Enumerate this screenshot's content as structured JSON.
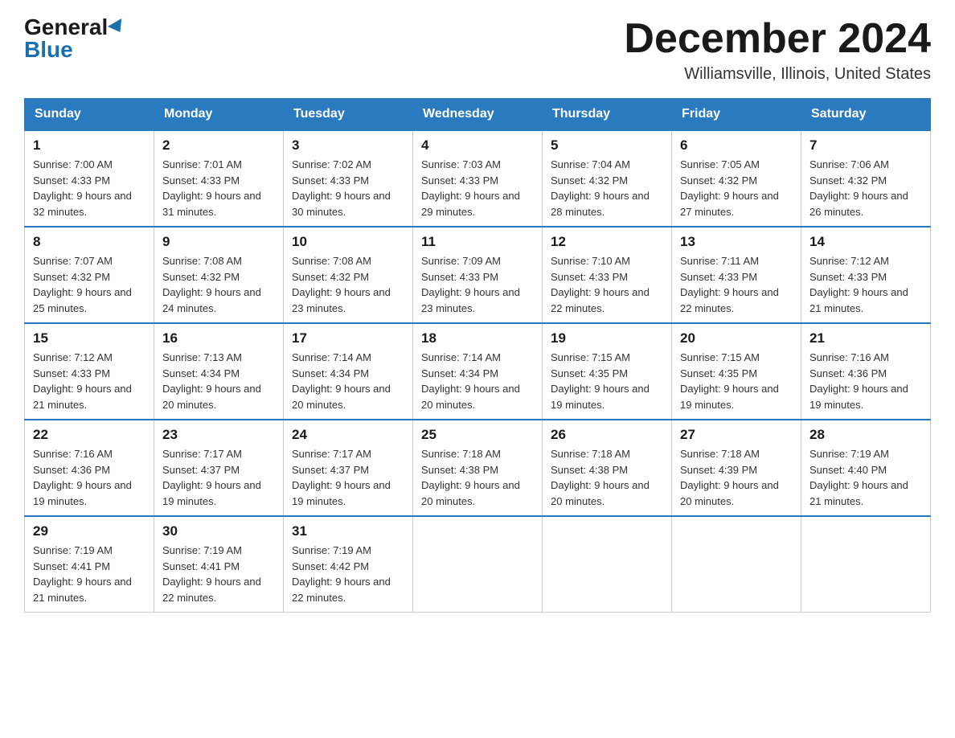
{
  "logo": {
    "general": "General",
    "blue": "Blue"
  },
  "title": "December 2024",
  "subtitle": "Williamsville, Illinois, United States",
  "days_of_week": [
    "Sunday",
    "Monday",
    "Tuesday",
    "Wednesday",
    "Thursday",
    "Friday",
    "Saturday"
  ],
  "weeks": [
    [
      {
        "day": "1",
        "sunrise": "Sunrise: 7:00 AM",
        "sunset": "Sunset: 4:33 PM",
        "daylight": "Daylight: 9 hours and 32 minutes."
      },
      {
        "day": "2",
        "sunrise": "Sunrise: 7:01 AM",
        "sunset": "Sunset: 4:33 PM",
        "daylight": "Daylight: 9 hours and 31 minutes."
      },
      {
        "day": "3",
        "sunrise": "Sunrise: 7:02 AM",
        "sunset": "Sunset: 4:33 PM",
        "daylight": "Daylight: 9 hours and 30 minutes."
      },
      {
        "day": "4",
        "sunrise": "Sunrise: 7:03 AM",
        "sunset": "Sunset: 4:33 PM",
        "daylight": "Daylight: 9 hours and 29 minutes."
      },
      {
        "day": "5",
        "sunrise": "Sunrise: 7:04 AM",
        "sunset": "Sunset: 4:32 PM",
        "daylight": "Daylight: 9 hours and 28 minutes."
      },
      {
        "day": "6",
        "sunrise": "Sunrise: 7:05 AM",
        "sunset": "Sunset: 4:32 PM",
        "daylight": "Daylight: 9 hours and 27 minutes."
      },
      {
        "day": "7",
        "sunrise": "Sunrise: 7:06 AM",
        "sunset": "Sunset: 4:32 PM",
        "daylight": "Daylight: 9 hours and 26 minutes."
      }
    ],
    [
      {
        "day": "8",
        "sunrise": "Sunrise: 7:07 AM",
        "sunset": "Sunset: 4:32 PM",
        "daylight": "Daylight: 9 hours and 25 minutes."
      },
      {
        "day": "9",
        "sunrise": "Sunrise: 7:08 AM",
        "sunset": "Sunset: 4:32 PM",
        "daylight": "Daylight: 9 hours and 24 minutes."
      },
      {
        "day": "10",
        "sunrise": "Sunrise: 7:08 AM",
        "sunset": "Sunset: 4:32 PM",
        "daylight": "Daylight: 9 hours and 23 minutes."
      },
      {
        "day": "11",
        "sunrise": "Sunrise: 7:09 AM",
        "sunset": "Sunset: 4:33 PM",
        "daylight": "Daylight: 9 hours and 23 minutes."
      },
      {
        "day": "12",
        "sunrise": "Sunrise: 7:10 AM",
        "sunset": "Sunset: 4:33 PM",
        "daylight": "Daylight: 9 hours and 22 minutes."
      },
      {
        "day": "13",
        "sunrise": "Sunrise: 7:11 AM",
        "sunset": "Sunset: 4:33 PM",
        "daylight": "Daylight: 9 hours and 22 minutes."
      },
      {
        "day": "14",
        "sunrise": "Sunrise: 7:12 AM",
        "sunset": "Sunset: 4:33 PM",
        "daylight": "Daylight: 9 hours and 21 minutes."
      }
    ],
    [
      {
        "day": "15",
        "sunrise": "Sunrise: 7:12 AM",
        "sunset": "Sunset: 4:33 PM",
        "daylight": "Daylight: 9 hours and 21 minutes."
      },
      {
        "day": "16",
        "sunrise": "Sunrise: 7:13 AM",
        "sunset": "Sunset: 4:34 PM",
        "daylight": "Daylight: 9 hours and 20 minutes."
      },
      {
        "day": "17",
        "sunrise": "Sunrise: 7:14 AM",
        "sunset": "Sunset: 4:34 PM",
        "daylight": "Daylight: 9 hours and 20 minutes."
      },
      {
        "day": "18",
        "sunrise": "Sunrise: 7:14 AM",
        "sunset": "Sunset: 4:34 PM",
        "daylight": "Daylight: 9 hours and 20 minutes."
      },
      {
        "day": "19",
        "sunrise": "Sunrise: 7:15 AM",
        "sunset": "Sunset: 4:35 PM",
        "daylight": "Daylight: 9 hours and 19 minutes."
      },
      {
        "day": "20",
        "sunrise": "Sunrise: 7:15 AM",
        "sunset": "Sunset: 4:35 PM",
        "daylight": "Daylight: 9 hours and 19 minutes."
      },
      {
        "day": "21",
        "sunrise": "Sunrise: 7:16 AM",
        "sunset": "Sunset: 4:36 PM",
        "daylight": "Daylight: 9 hours and 19 minutes."
      }
    ],
    [
      {
        "day": "22",
        "sunrise": "Sunrise: 7:16 AM",
        "sunset": "Sunset: 4:36 PM",
        "daylight": "Daylight: 9 hours and 19 minutes."
      },
      {
        "day": "23",
        "sunrise": "Sunrise: 7:17 AM",
        "sunset": "Sunset: 4:37 PM",
        "daylight": "Daylight: 9 hours and 19 minutes."
      },
      {
        "day": "24",
        "sunrise": "Sunrise: 7:17 AM",
        "sunset": "Sunset: 4:37 PM",
        "daylight": "Daylight: 9 hours and 19 minutes."
      },
      {
        "day": "25",
        "sunrise": "Sunrise: 7:18 AM",
        "sunset": "Sunset: 4:38 PM",
        "daylight": "Daylight: 9 hours and 20 minutes."
      },
      {
        "day": "26",
        "sunrise": "Sunrise: 7:18 AM",
        "sunset": "Sunset: 4:38 PM",
        "daylight": "Daylight: 9 hours and 20 minutes."
      },
      {
        "day": "27",
        "sunrise": "Sunrise: 7:18 AM",
        "sunset": "Sunset: 4:39 PM",
        "daylight": "Daylight: 9 hours and 20 minutes."
      },
      {
        "day": "28",
        "sunrise": "Sunrise: 7:19 AM",
        "sunset": "Sunset: 4:40 PM",
        "daylight": "Daylight: 9 hours and 21 minutes."
      }
    ],
    [
      {
        "day": "29",
        "sunrise": "Sunrise: 7:19 AM",
        "sunset": "Sunset: 4:41 PM",
        "daylight": "Daylight: 9 hours and 21 minutes."
      },
      {
        "day": "30",
        "sunrise": "Sunrise: 7:19 AM",
        "sunset": "Sunset: 4:41 PM",
        "daylight": "Daylight: 9 hours and 22 minutes."
      },
      {
        "day": "31",
        "sunrise": "Sunrise: 7:19 AM",
        "sunset": "Sunset: 4:42 PM",
        "daylight": "Daylight: 9 hours and 22 minutes."
      },
      null,
      null,
      null,
      null
    ]
  ]
}
